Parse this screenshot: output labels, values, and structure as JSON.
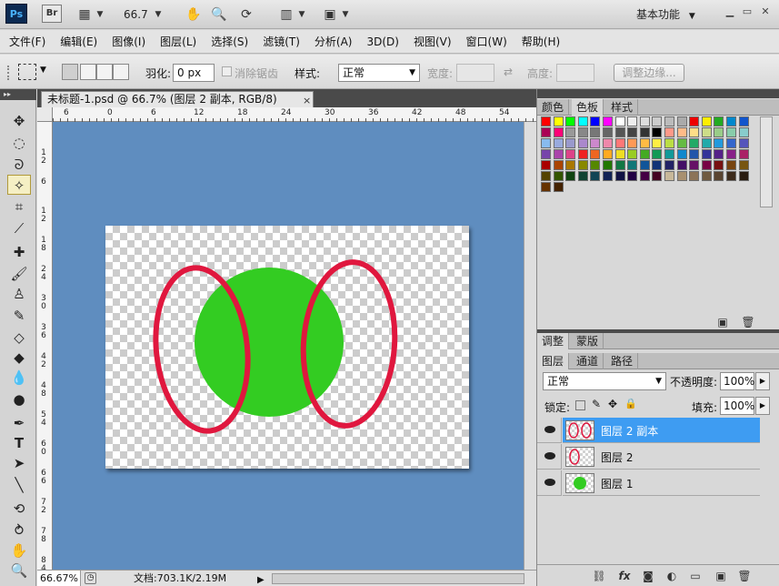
{
  "appbar": {
    "ps_logo": "Ps",
    "br_logo": "Br",
    "zoom_value": "66.7",
    "workspace": "基本功能",
    "icons": [
      "layout-icon",
      "hand-icon",
      "zoom-icon",
      "rotate-icon",
      "arrange-icon",
      "screen-mode-icon"
    ]
  },
  "menubar": {
    "items": [
      "文件(F)",
      "编辑(E)",
      "图像(I)",
      "图层(L)",
      "选择(S)",
      "滤镜(T)",
      "分析(A)",
      "3D(D)",
      "视图(V)",
      "窗口(W)",
      "帮助(H)"
    ]
  },
  "options": {
    "feather_label": "羽化:",
    "feather_value": "0 px",
    "antialias_label": "消除锯齿",
    "style_label": "样式:",
    "style_value": "正常",
    "width_label": "宽度:",
    "height_label": "高度:",
    "refine_label": "调整边缘..."
  },
  "document": {
    "tab_title": "未标题-1.psd @ 66.7% (图层 2 副本, RGB/8)",
    "close": "×",
    "ruler_top": [
      "6",
      "0",
      "6",
      "12",
      "18",
      "24",
      "30",
      "36",
      "42",
      "48",
      "54"
    ],
    "ruler_left": [
      "1\n2",
      "6",
      "1\n2",
      "1\n8",
      "2\n4",
      "3\n0",
      "3\n6",
      "4\n2",
      "4\n8",
      "5\n4",
      "6\n0",
      "6\n6",
      "7\n2",
      "7\n8",
      "8\n4"
    ],
    "canvas_colors": {
      "circle": "#33cc22",
      "ring": "#e0173e",
      "pasteboard": "#5f8dbf"
    }
  },
  "status": {
    "zoom": "66.67%",
    "doc_info": "文档:703.1K/2.19M"
  },
  "color_panel": {
    "tabs": [
      "颜色",
      "色板",
      "样式"
    ],
    "active_tab": "色板"
  },
  "swatch_rows": [
    [
      "#ff0000",
      "#ffff00",
      "#00ff00",
      "#00ffff",
      "#0000ff",
      "#ff00ff",
      "#ffffff",
      "#eeeeee",
      "#dddddd",
      "#cccccc",
      "#bbbbbb",
      "#aaaaaa",
      "#ee0000",
      "#ffee00",
      "#22aa22",
      "#0088cc",
      "#1155cc"
    ],
    [
      "#aa0055",
      "#ff0077",
      "#999999",
      "#888888",
      "#777777",
      "#666666",
      "#555555",
      "#444444",
      "#333333",
      "#000000",
      "#ff9988",
      "#ffbb88",
      "#ffdd88",
      "#ccdd88",
      "#99cc88",
      "#88ccaa",
      "#88cccc"
    ],
    [
      "#88bbee",
      "#99aadd",
      "#9999cc",
      "#aa88cc",
      "#cc88cc",
      "#ee88aa",
      "#ff7777",
      "#ff9955",
      "#ffbb44",
      "#ffee44",
      "#bbdd44",
      "#66bb44",
      "#22aa66",
      "#22aaaa",
      "#2299dd",
      "#3366cc",
      "#5555bb"
    ],
    [
      "#7744aa",
      "#aa44aa",
      "#dd4488",
      "#ee2222",
      "#ee6622",
      "#ffaa22",
      "#eedd22",
      "#99cc22",
      "#44aa22",
      "#119955",
      "#119999",
      "#1188cc",
      "#2255aa",
      "#333399",
      "#552288",
      "#882288",
      "#aa2266"
    ],
    [
      "#aa0000",
      "#aa4400",
      "#aa7700",
      "#888800",
      "#558800",
      "#227700",
      "#117744",
      "#117777",
      "#115599",
      "#113377",
      "#222266",
      "#441166",
      "#661166",
      "#770044",
      "#771111",
      "#774411",
      "#775511"
    ],
    [
      "#554400",
      "#335500",
      "#114411",
      "#114433",
      "#114455",
      "#112255",
      "#111144",
      "#220044",
      "#440044",
      "#440022",
      "#c8b89a",
      "#a89070",
      "#8c7458",
      "#705a40",
      "#5a4430",
      "#3e2c1c",
      "#2a1c10"
    ],
    [
      "#663300",
      "#442200"
    ]
  ],
  "layers_panel": {
    "top_tabs": [
      "调整",
      "蒙版"
    ],
    "tabs": [
      "图层",
      "通道",
      "路径"
    ],
    "blend_mode": "正常",
    "opacity_label": "不透明度:",
    "opacity_value": "100%",
    "lock_label": "锁定:",
    "fill_label": "填充:",
    "fill_value": "100%",
    "layers": [
      {
        "name": "图层 2 副本",
        "selected": true
      },
      {
        "name": "图层 2",
        "selected": false
      },
      {
        "name": "图层 1",
        "selected": false
      }
    ]
  }
}
